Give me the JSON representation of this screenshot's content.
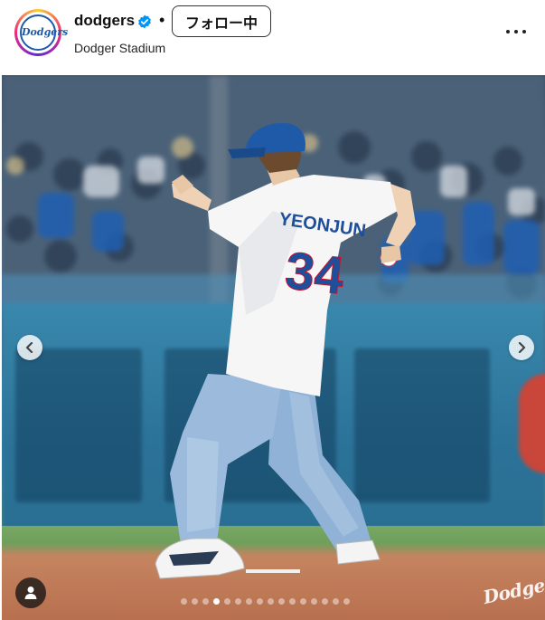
{
  "header": {
    "username": "dodgers",
    "follow_label": "フォロー中",
    "location": "Dodger Stadium",
    "avatar_text": "Dodgers",
    "separator": "•"
  },
  "post": {
    "carousel": {
      "total": 16,
      "active_index": 3
    },
    "jersey": {
      "name": "YEONJUN",
      "number": "34"
    },
    "watermark": "Dodgers"
  },
  "colors": {
    "verified": "#0095f6",
    "dodger_blue": "#1e5aa8"
  },
  "icons": [
    "verified-badge-icon",
    "more-options-icon",
    "chevron-left-icon",
    "chevron-right-icon",
    "user-tag-icon"
  ]
}
